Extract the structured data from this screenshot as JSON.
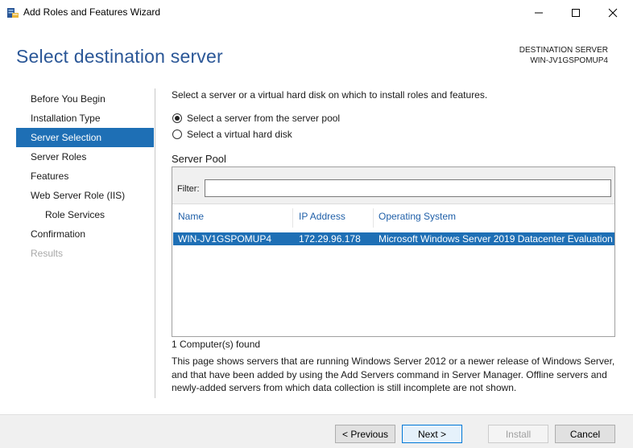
{
  "window": {
    "title": "Add Roles and Features Wizard",
    "icon": "server-manager-icon",
    "controls": [
      "minimize-icon",
      "maximize-icon",
      "close-icon"
    ]
  },
  "header": {
    "page_title": "Select destination server",
    "destination_label": "DESTINATION SERVER",
    "destination_value": "WIN-JV1GSPOMUP4"
  },
  "nav": {
    "items": [
      {
        "label": "Before You Begin",
        "state": "normal"
      },
      {
        "label": "Installation Type",
        "state": "normal"
      },
      {
        "label": "Server Selection",
        "state": "active"
      },
      {
        "label": "Server Roles",
        "state": "normal"
      },
      {
        "label": "Features",
        "state": "normal"
      },
      {
        "label": "Web Server Role (IIS)",
        "state": "normal"
      },
      {
        "label": "Role Services",
        "state": "normal"
      },
      {
        "label": "Confirmation",
        "state": "normal"
      },
      {
        "label": "Results",
        "state": "disabled"
      }
    ]
  },
  "main": {
    "intro": "Select a server or a virtual hard disk on which to install roles and features.",
    "options": [
      {
        "label": "Select a server from the server pool",
        "checked": true
      },
      {
        "label": "Select a virtual hard disk",
        "checked": false
      }
    ],
    "pool_title": "Server Pool",
    "filter_label": "Filter:",
    "filter_value": "",
    "columns": [
      "Name",
      "IP Address",
      "Operating System"
    ],
    "rows": [
      {
        "name": "WIN-JV1GSPOMUP4",
        "ip": "172.29.96.178",
        "os": "Microsoft Windows Server 2019 Datacenter Evaluation"
      }
    ],
    "found": "1 Computer(s) found",
    "description": "This page shows servers that are running Windows Server 2012 or a newer release of Windows Server, and that have been added by using the Add Servers command in Server Manager. Offline servers and newly-added servers from which data collection is still incomplete are not shown."
  },
  "footer": {
    "previous": "< Previous",
    "next": "Next >",
    "install": "Install",
    "cancel": "Cancel"
  },
  "colors": {
    "accent": "#1e6fb5",
    "title_blue": "#2b5797",
    "header_link": "#1f5fa8"
  }
}
